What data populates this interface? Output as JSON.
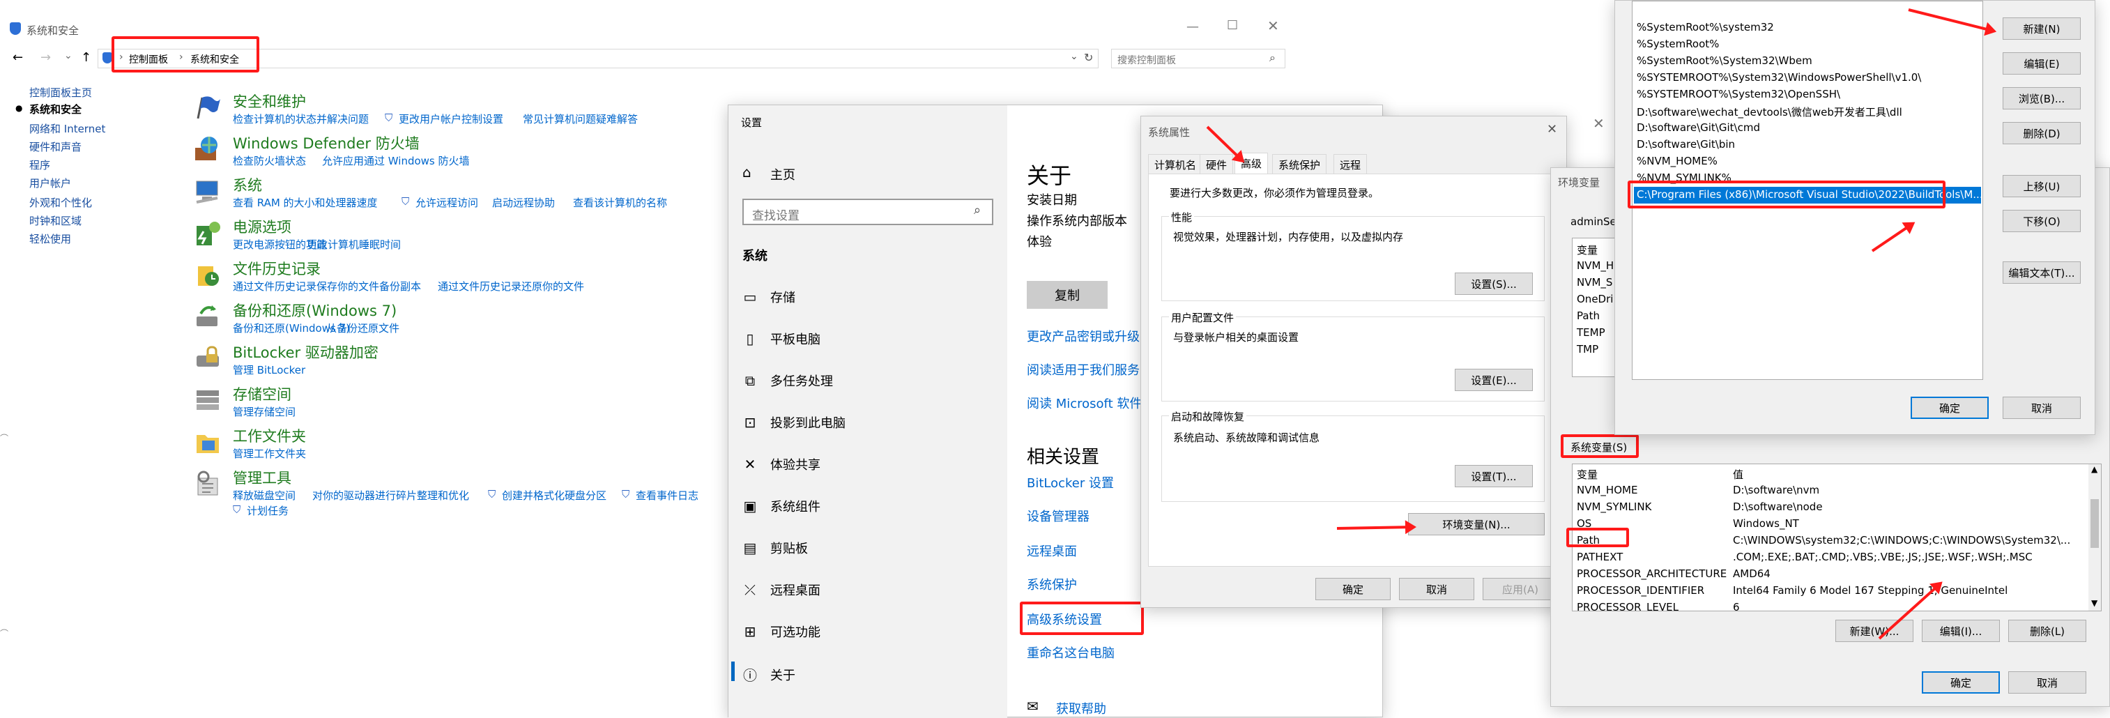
{
  "cp": {
    "title": "系统和安全",
    "breadcrumb": [
      "控制面板",
      "系统和安全"
    ],
    "search_placeholder": "搜索控制面板",
    "left_nav": [
      {
        "label": "控制面板主页",
        "bold": false
      },
      {
        "label": "系统和安全",
        "bold": true
      },
      {
        "label": "网络和 Internet",
        "bold": false
      },
      {
        "label": "硬件和声音",
        "bold": false
      },
      {
        "label": "程序",
        "bold": false
      },
      {
        "label": "用户帐户",
        "bold": false
      },
      {
        "label": "外观和个性化",
        "bold": false
      },
      {
        "label": "时钟和区域",
        "bold": false
      },
      {
        "label": "轻松使用",
        "bold": false
      }
    ],
    "sections": [
      {
        "title": "安全和维护",
        "icon": "flag-icon",
        "links": [
          "检查计算机的状态并解决问题",
          "更改用户帐户控制设置",
          "常见计算机问题疑难解答"
        ]
      },
      {
        "title": "Windows Defender 防火墙",
        "icon": "firewall-icon",
        "links": [
          "检查防火墙状态",
          "允许应用通过 Windows 防火墙"
        ]
      },
      {
        "title": "系统",
        "icon": "computer-icon",
        "links": [
          "查看 RAM 的大小和处理器速度",
          "允许远程访问",
          "启动远程协助",
          "查看该计算机的名称"
        ]
      },
      {
        "title": "电源选项",
        "icon": "power-icon",
        "links": [
          "更改电源按钮的功能",
          "更改计算机睡眠时间"
        ]
      },
      {
        "title": "文件历史记录",
        "icon": "file-history-icon",
        "links": [
          "通过文件历史记录保存你的文件备份副本",
          "通过文件历史记录还原你的文件"
        ]
      },
      {
        "title": "备份和还原(Windows 7)",
        "icon": "backup-icon",
        "links": [
          "备份和还原(Windows 7)",
          "从备份还原文件"
        ]
      },
      {
        "title": "BitLocker 驱动器加密",
        "icon": "bitlocker-icon",
        "links": [
          "管理 BitLocker"
        ]
      },
      {
        "title": "存储空间",
        "icon": "storage-icon",
        "links": [
          "管理存储空间"
        ]
      },
      {
        "title": "工作文件夹",
        "icon": "folder-icon",
        "links": [
          "管理工作文件夹"
        ]
      },
      {
        "title": "管理工具",
        "icon": "tools-icon",
        "links": [
          "释放磁盘空间",
          "对你的驱动器进行碎片整理和优化",
          "创建并格式化硬盘分区",
          "查看事件日志",
          "计划任务"
        ]
      }
    ]
  },
  "settings": {
    "title": "设置",
    "home": "主页",
    "search_placeholder": "查找设置",
    "category": "系统",
    "nav": [
      {
        "label": "存储",
        "icon": "storage-icon",
        "glyph": "▭"
      },
      {
        "label": "平板电脑",
        "icon": "tablet-icon",
        "glyph": "▯"
      },
      {
        "label": "多任务处理",
        "icon": "multitask-icon",
        "glyph": "⧉"
      },
      {
        "label": "投影到此电脑",
        "icon": "project-icon",
        "glyph": "⊡"
      },
      {
        "label": "体验共享",
        "icon": "share-icon",
        "glyph": "✕"
      },
      {
        "label": "系统组件",
        "icon": "components-icon",
        "glyph": "▣"
      },
      {
        "label": "剪贴板",
        "icon": "clipboard-icon",
        "glyph": "▤"
      },
      {
        "label": "远程桌面",
        "icon": "remote-icon",
        "glyph": "⤫"
      },
      {
        "label": "可选功能",
        "icon": "optional-features-icon",
        "glyph": "⊞"
      },
      {
        "label": "关于",
        "icon": "info-icon",
        "glyph": "ⓘ"
      }
    ],
    "about_heading": "关于",
    "about_rows": [
      "安装日期",
      "操作系统内部版本",
      "体验"
    ],
    "copy_btn": "复制",
    "links": [
      "更改产品密钥或升级",
      "阅读适用于我们服务",
      "阅读 Microsoft 软件许"
    ],
    "related_heading": "相关设置",
    "related": [
      "BitLocker 设置",
      "设备管理器",
      "远程桌面",
      "系统保护",
      "高级系统设置",
      "重命名这台电脑"
    ],
    "help": "获取帮助"
  },
  "sysprops": {
    "title": "系统属性",
    "tabs": [
      "计算机名",
      "硬件",
      "高级",
      "系统保护",
      "远程"
    ],
    "admin_note": "要进行大多数更改，你必须作为管理员登录。",
    "perf_title": "性能",
    "perf_desc": "视觉效果，处理器计划，内存使用，以及虚拟内存",
    "perf_btn": "设置(S)...",
    "profile_title": "用户配置文件",
    "profile_desc": "与登录帐户相关的桌面设置",
    "profile_btn": "设置(E)...",
    "startup_title": "启动和故障恢复",
    "startup_desc": "系统启动、系统故障和调试信息",
    "startup_btn": "设置(T)...",
    "env_btn": "环境变量(N)...",
    "ok": "确定",
    "cancel": "取消",
    "apply": "应用(A)"
  },
  "envvars": {
    "title": "环境变量",
    "user_label": "adminSer",
    "user_col": "变量",
    "user_vars": [
      "NVM_H",
      "NVM_S",
      "OneDri",
      "Path",
      "TEMP",
      "TMP"
    ],
    "sys_label": "系统变量(S)",
    "col_var": "变量",
    "col_val": "值",
    "sys_vars": [
      {
        "name": "NVM_HOME",
        "value": "D:\\software\\nvm"
      },
      {
        "name": "NVM_SYMLINK",
        "value": "D:\\software\\node"
      },
      {
        "name": "OS",
        "value": "Windows_NT"
      },
      {
        "name": "Path",
        "value": "C:\\WINDOWS\\system32;C:\\WINDOWS;C:\\WINDOWS\\System32\\..."
      },
      {
        "name": "PATHEXT",
        "value": ".COM;.EXE;.BAT;.CMD;.VBS;.VBE;.JS;.JSE;.WSF;.WSH;.MSC"
      },
      {
        "name": "PROCESSOR_ARCHITECTURE",
        "value": "AMD64"
      },
      {
        "name": "PROCESSOR_IDENTIFIER",
        "value": "Intel64 Family 6 Model 167 Stepping 1, GenuineIntel"
      },
      {
        "name": "PROCESSOR_LEVEL",
        "value": "6"
      }
    ],
    "new_btn": "新建(W)...",
    "edit_btn": "编辑(I)...",
    "del_btn": "删除(L)",
    "ok": "确定",
    "cancel": "取消"
  },
  "editpath": {
    "entries": [
      "%SystemRoot%\\system32",
      "%SystemRoot%",
      "%SystemRoot%\\System32\\Wbem",
      "%SYSTEMROOT%\\System32\\WindowsPowerShell\\v1.0\\",
      "%SYSTEMROOT%\\System32\\OpenSSH\\",
      "D:\\software\\wechat_devtools\\微信web开发者工具\\dll",
      "D:\\software\\Git\\Git\\cmd",
      "D:\\software\\Git\\bin",
      "%NVM_HOME%",
      "%NVM_SYMLINK%",
      "C:\\Program Files (x86)\\Microsoft Visual Studio\\2022\\BuildTools\\M..."
    ],
    "buttons": [
      "新建(N)",
      "编辑(E)",
      "浏览(B)...",
      "删除(D)",
      "上移(U)",
      "下移(O)",
      "编辑文本(T)..."
    ],
    "ok": "确定",
    "cancel": "取消"
  }
}
